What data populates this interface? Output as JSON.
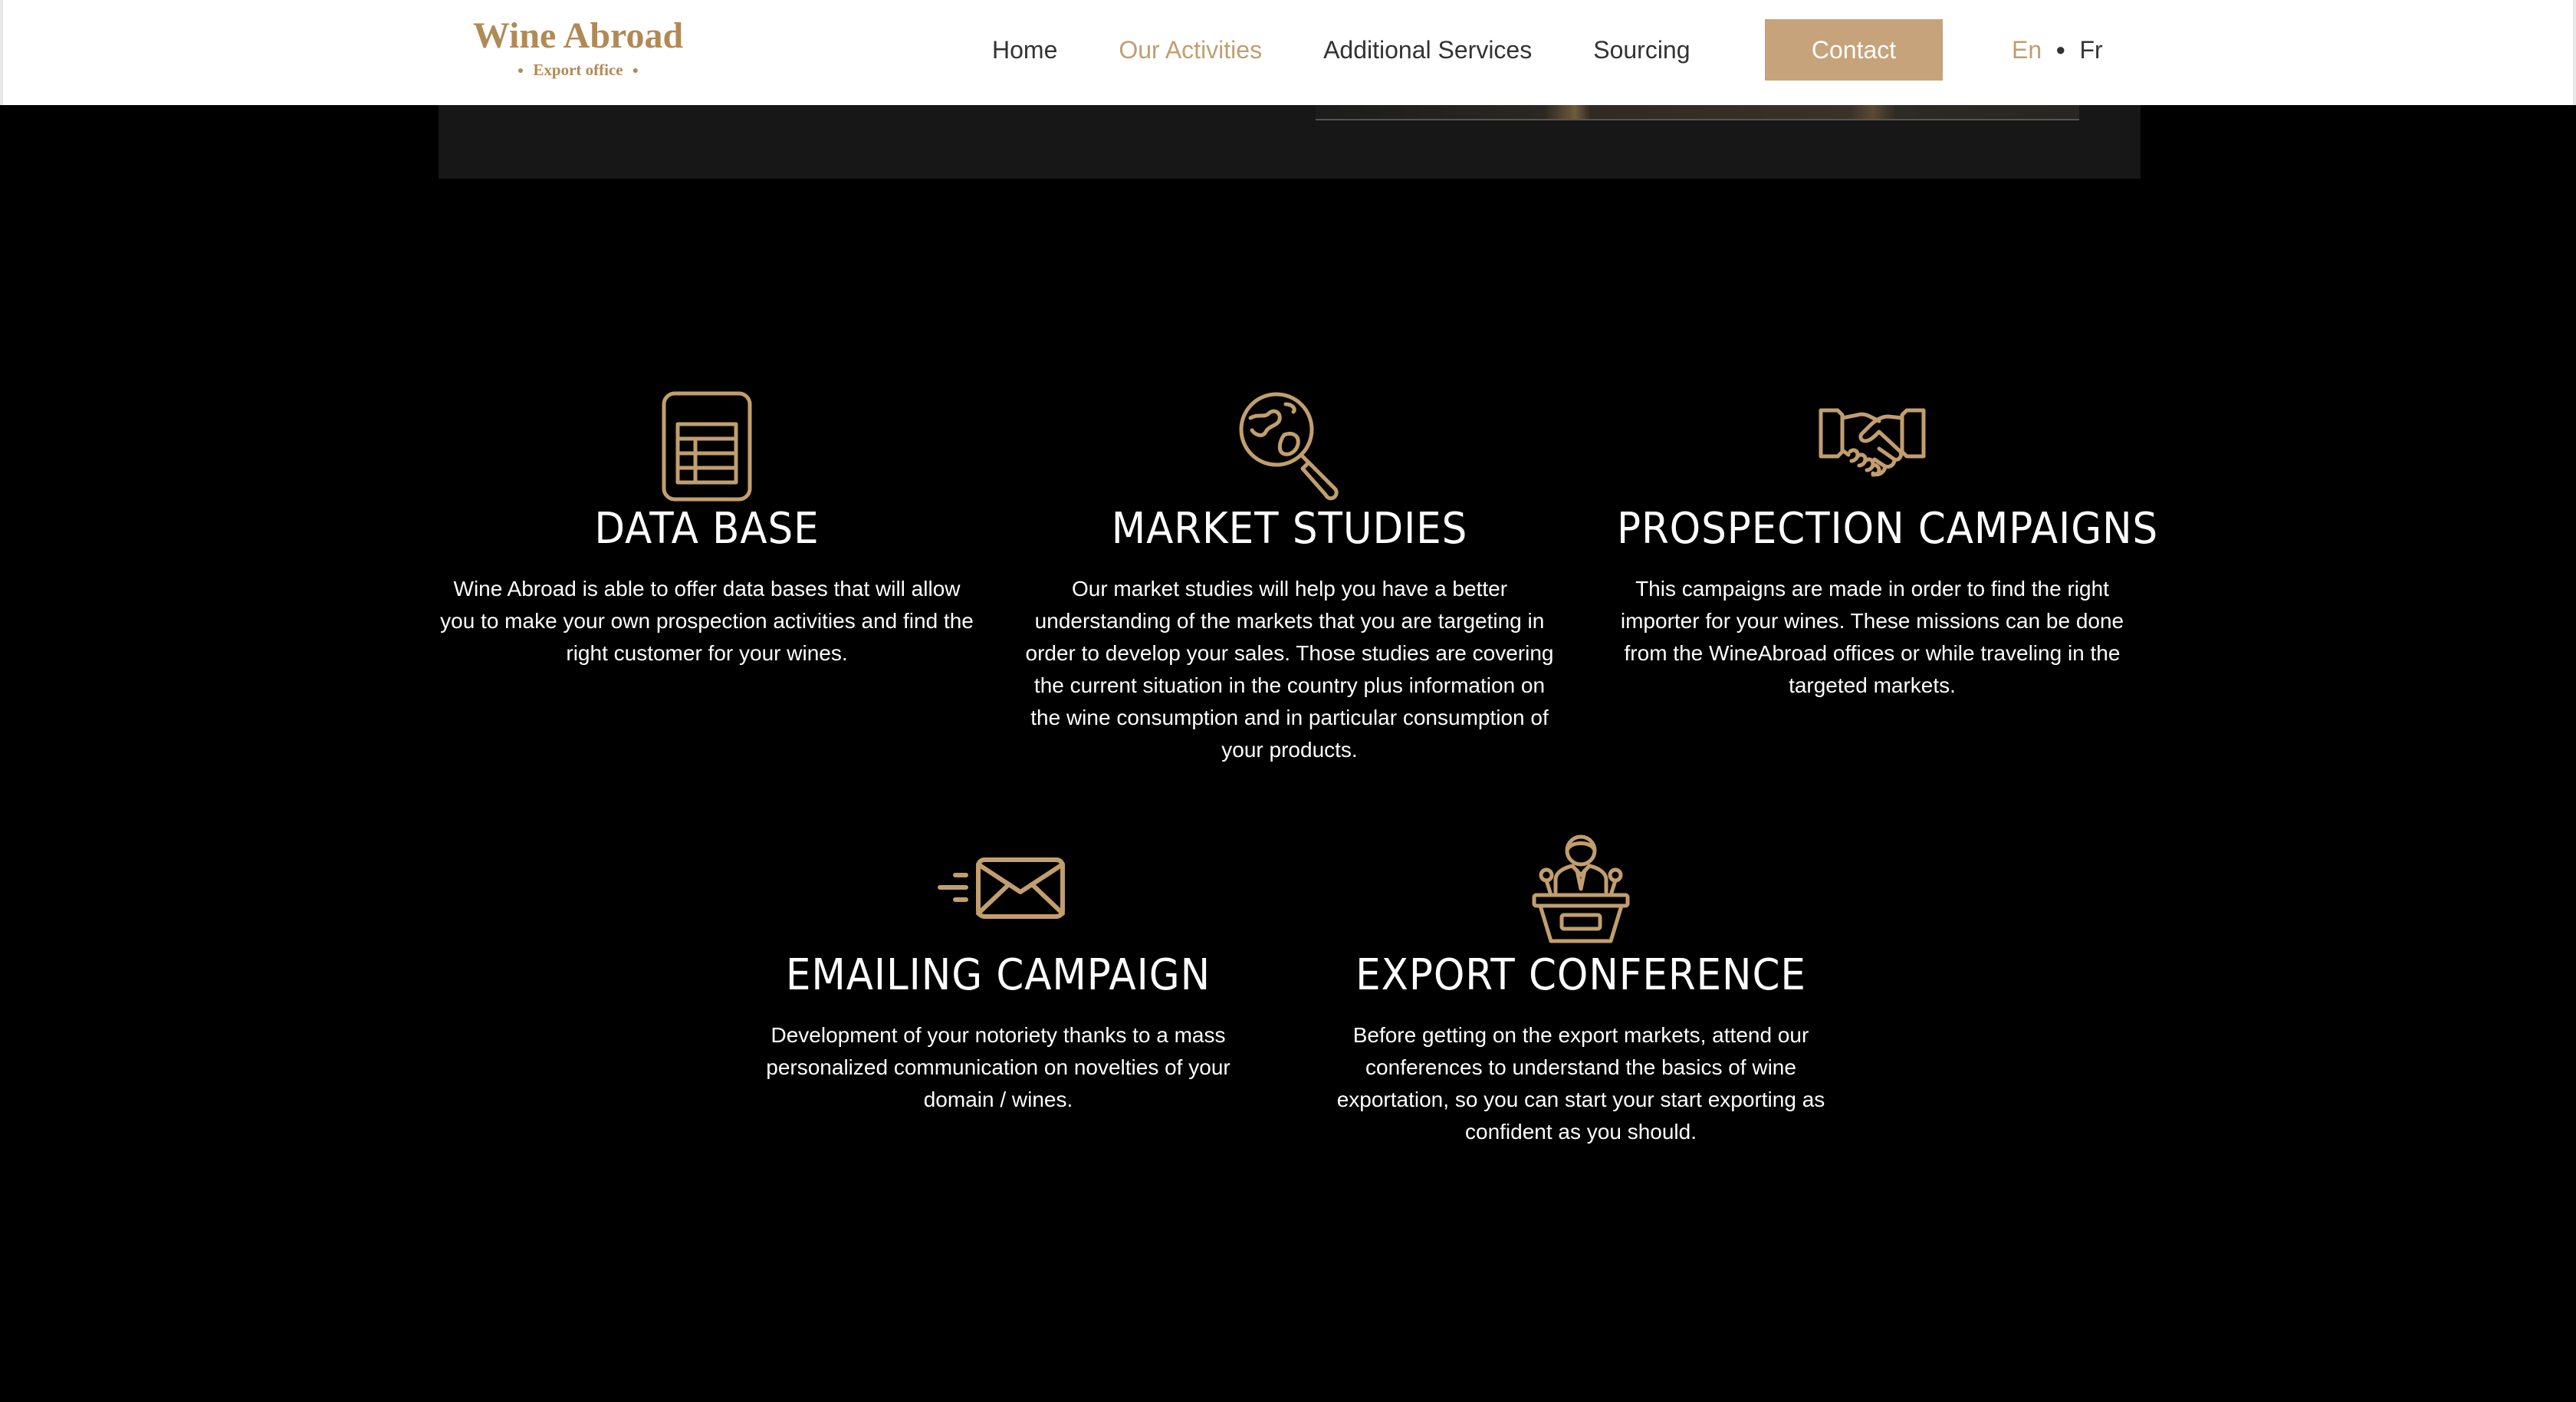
{
  "header": {
    "logo": {
      "title": "Wine Abroad",
      "subtitle": "Export office"
    },
    "nav": {
      "items": [
        {
          "label": "Home",
          "active": false
        },
        {
          "label": "Our Activities",
          "active": true
        },
        {
          "label": "Additional Services",
          "active": false
        },
        {
          "label": "Sourcing",
          "active": false
        }
      ],
      "contact_label": "Contact"
    },
    "languages": {
      "current": "En",
      "other": "Fr"
    }
  },
  "colors": {
    "accent_gold": "#c29e6f",
    "button_gold": "#c6a37a",
    "logo_gold": "#b08a56",
    "background": "#000000",
    "panel": "#171717"
  },
  "services": [
    {
      "icon": "spreadsheet-icon",
      "title": "DATA BASE",
      "description": "Wine Abroad is able to offer data bases that will allow you to make your own prospection activities and find the right customer for your wines."
    },
    {
      "icon": "globe-magnifier-icon",
      "title": "MARKET STUDIES",
      "description": "Our market studies will help you have a better understanding of the markets that you are targeting in order to develop your sales. Those studies are covering the current situation in the country plus information on the wine consumption and in particular consumption of your products."
    },
    {
      "icon": "handshake-icon",
      "title": "PROSPECTION CAMPAIGNS",
      "description": "This campaigns are made in order to find the right importer for your wines. These missions can be done from the WineAbroad offices or while traveling in the targeted markets."
    },
    {
      "icon": "envelope-icon",
      "title": "EMAILING CAMPAIGN",
      "description": "Development of your notoriety thanks to a mass personalized communication on novelties of your domain / wines."
    },
    {
      "icon": "speaker-podium-icon",
      "title": "EXPORT CONFERENCE",
      "description": "Before getting on the export markets, attend our conferences to understand the basics of wine exportation, so you can start your start exporting as confident as you should."
    }
  ]
}
